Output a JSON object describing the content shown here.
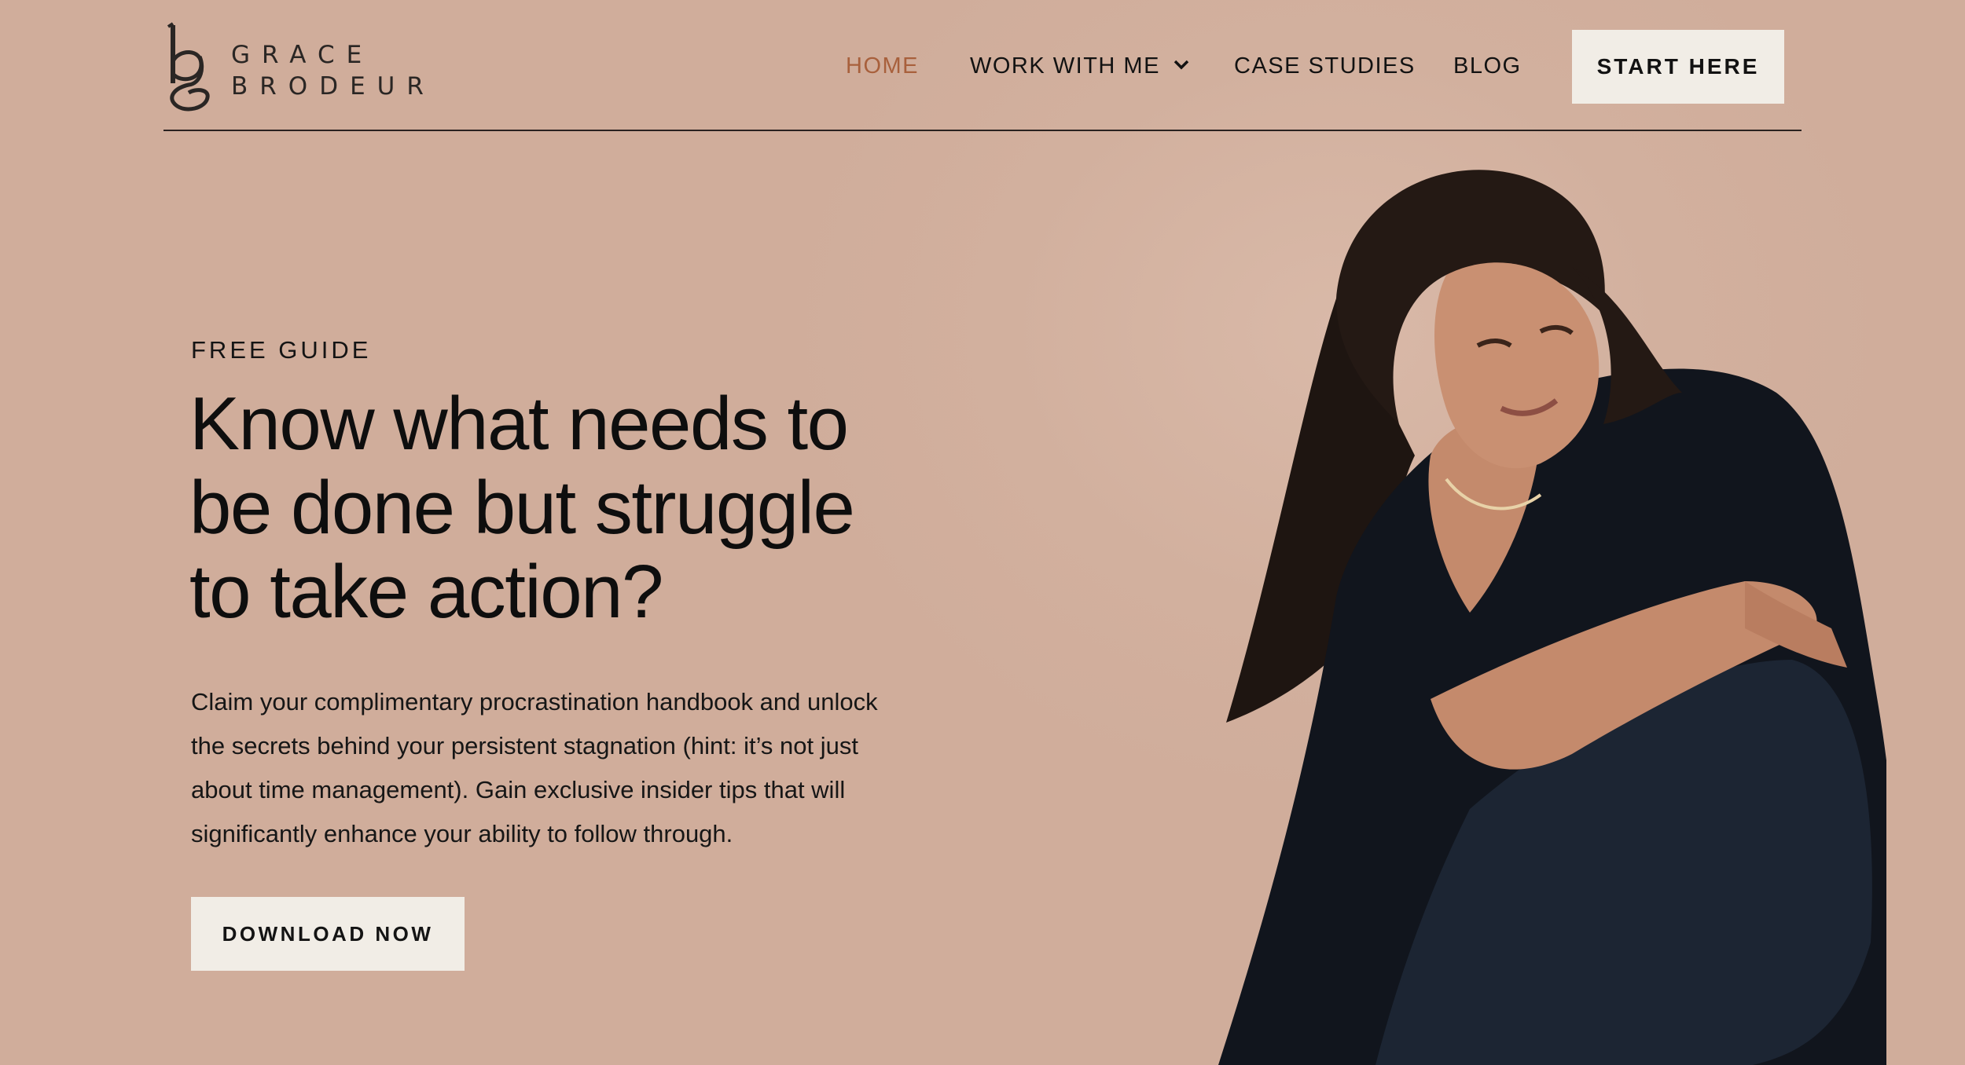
{
  "brand": {
    "name_line1": "GRACE",
    "name_line2": "BRODEUR",
    "logo_icon": "bg-monogram-icon"
  },
  "nav": {
    "items": [
      {
        "label": "HOME",
        "active": true
      },
      {
        "label": "WORK WITH ME",
        "has_dropdown": true
      },
      {
        "label": "CASE STUDIES"
      },
      {
        "label": "BLOG"
      }
    ],
    "cta_label": "START HERE"
  },
  "hero": {
    "eyebrow": "FREE GUIDE",
    "headline_lines": [
      "Know what needs to",
      "be done but struggle",
      "to take action?"
    ],
    "body_lines": [
      "Claim your complimentary procrastination handbook and unlock",
      "the secrets behind your persistent stagnation (hint: it’s not just",
      "about time management). Gain exclusive insider tips that will",
      "significantly enhance your ability to follow through."
    ],
    "button_label": "DOWNLOAD NOW",
    "image": "portrait-photo-woman-seated"
  },
  "colors": {
    "background": "#d2b09e",
    "nav_active": "#a8603c",
    "button_bg": "#f1ede6",
    "text": "#111111"
  }
}
